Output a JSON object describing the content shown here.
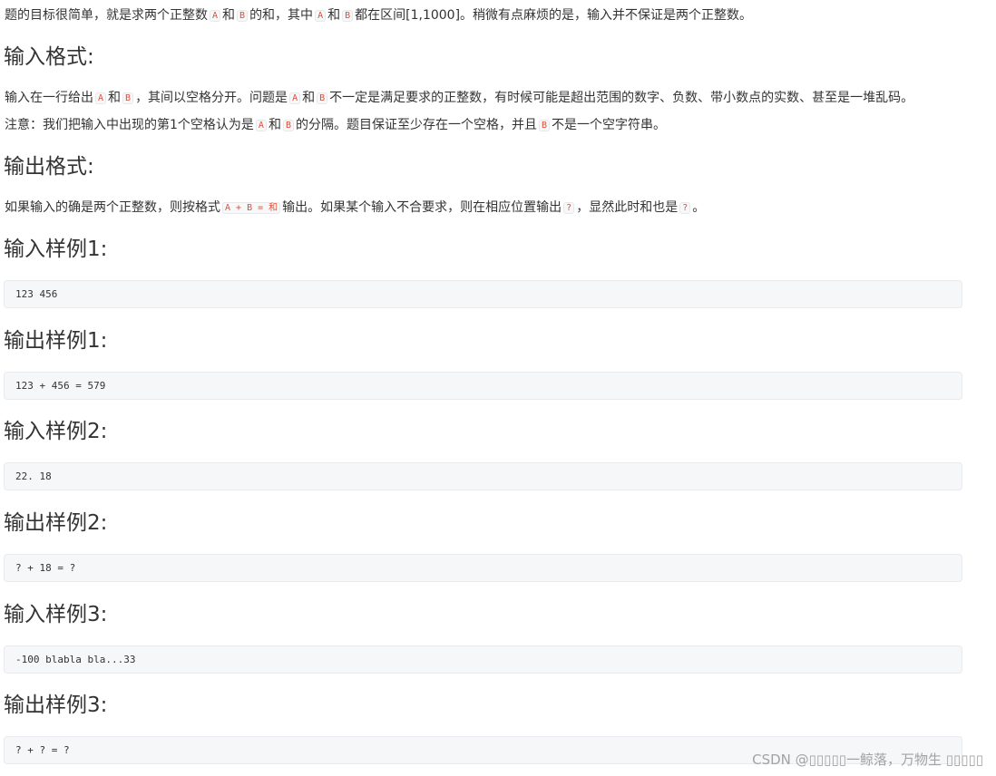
{
  "intro": {
    "t1": "题的目标很简单，就是求两个正整数",
    "c1": "A",
    "t2": "和",
    "c2": "B",
    "t3": "的和，其中",
    "c3": "A",
    "t4": "和",
    "c4": "B",
    "t5": "都在区间[1,1000]。稍微有点麻烦的是，输入并不保证是两个正整数。"
  },
  "input_format": {
    "heading": "输入格式:",
    "line1": {
      "t1": "输入在一行给出",
      "c1": "A",
      "t2": "和",
      "c2": "B",
      "t3": "，其间以空格分开。问题是",
      "c3": "A",
      "t4": "和",
      "c4": "B",
      "t5": "不一定是满足要求的正整数，有时候可能是超出范围的数字、负数、带小数点的实数、甚至是一堆乱码。"
    },
    "line2": {
      "t1": "注意：我们把输入中出现的第1个空格认为是",
      "c1": "A",
      "t2": "和",
      "c2": "B",
      "t3": "的分隔。题目保证至少存在一个空格，并且",
      "c3": "B",
      "t4": "不是一个空字符串。"
    }
  },
  "output_format": {
    "heading": "输出格式:",
    "line1": {
      "t1": "如果输入的确是两个正整数，则按格式",
      "c1": "A + B = 和",
      "t2": "输出。如果某个输入不合要求，则在相应位置输出",
      "c2": "?",
      "t3": "，显然此时和也是",
      "c3": "?",
      "t4": "。"
    }
  },
  "samples": [
    {
      "heading": "输入样例1:",
      "code": "123 456"
    },
    {
      "heading": "输出样例1:",
      "code": "123 + 456 = 579"
    },
    {
      "heading": "输入样例2:",
      "code": "22. 18"
    },
    {
      "heading": "输出样例2:",
      "code": "? + 18 = ?"
    },
    {
      "heading": "输入样例3:",
      "code": "-100 blabla bla...33"
    },
    {
      "heading": "输出样例3:",
      "code": "? + ? = ?"
    }
  ],
  "watermark": "CSDN @▯▯▯▯▯一鲸落，万物生 ▯▯▯▯▯"
}
